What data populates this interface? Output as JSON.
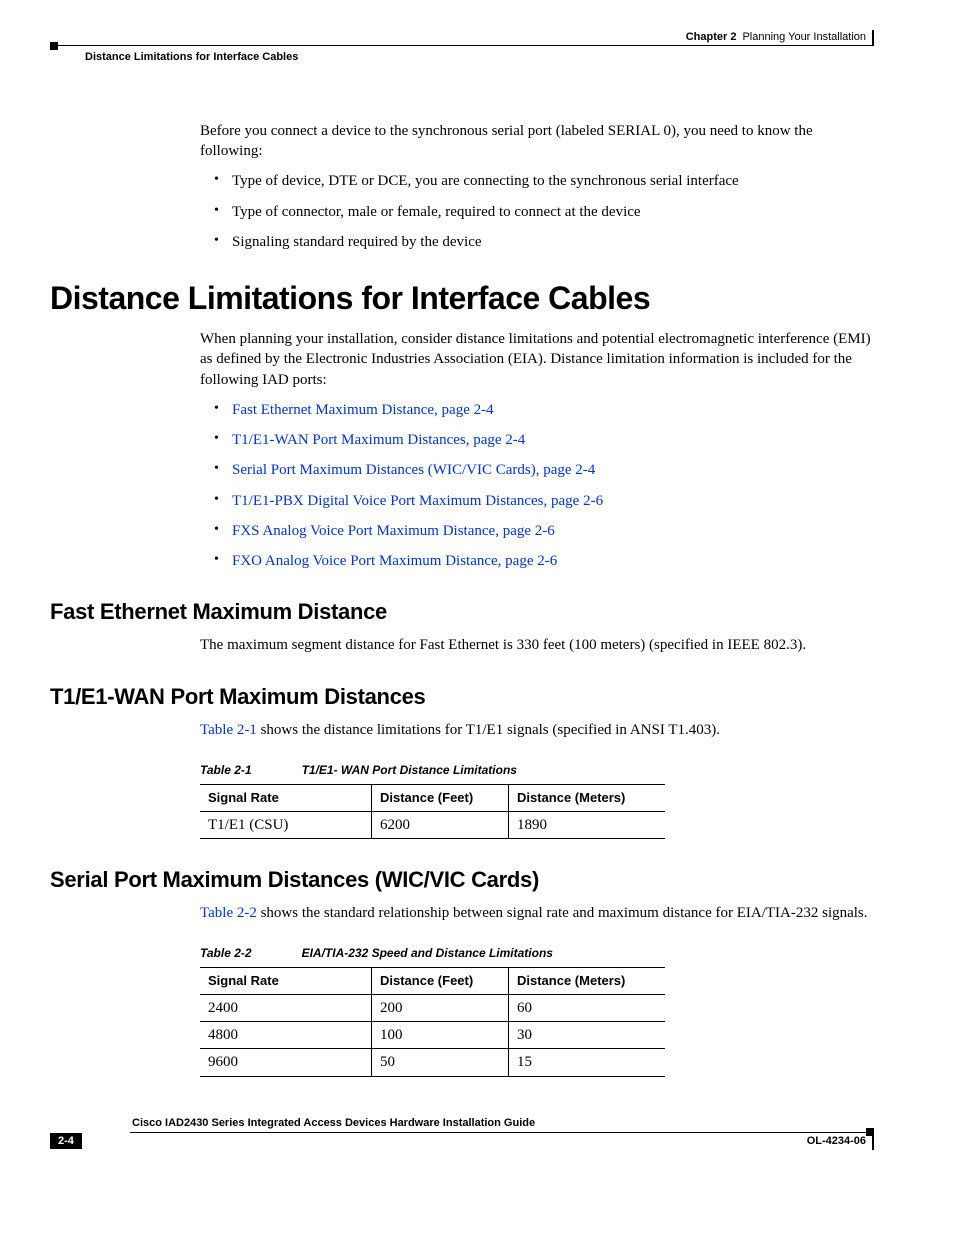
{
  "header": {
    "chapter_label": "Chapter 2",
    "chapter_title": "Planning Your Installation",
    "section_crumb": "Distance Limitations for Interface Cables"
  },
  "intro": {
    "p1": "Before you connect a device to the synchronous serial port (labeled SERIAL 0), you need to know the following:",
    "bullets": [
      "Type of device, DTE or DCE, you are connecting to the synchronous serial interface",
      "Type of connector, male or female, required to connect at the device",
      "Signaling standard required by the device"
    ]
  },
  "h1": "Distance Limitations for Interface Cables",
  "para_after_h1": "When planning your installation, consider distance limitations and potential electromagnetic interference (EMI) as defined by the Electronic Industries Association (EIA). Distance limitation information is included for the following IAD ports:",
  "links": [
    "Fast Ethernet Maximum Distance, page 2-4",
    "T1/E1-WAN Port Maximum Distances, page 2-4",
    "Serial Port Maximum Distances (WIC/VIC Cards), page 2-4",
    "T1/E1-PBX Digital Voice Port Maximum Distances, page 2-6",
    "FXS Analog Voice Port Maximum Distance, page 2-6",
    "FXO Analog Voice Port Maximum Distance, page 2-6"
  ],
  "sec1": {
    "h": "Fast Ethernet Maximum Distance",
    "p": "The maximum segment distance for Fast Ethernet is 330 feet (100 meters) (specified in IEEE 802.3)."
  },
  "sec2": {
    "h": "T1/E1-WAN Port Maximum Distances",
    "ref": "Table 2-1",
    "rest": " shows the distance limitations for T1/E1 signals (specified in ANSI T1.403).",
    "table_num": "Table 2-1",
    "table_title": "T1/E1- WAN Port Distance Limitations",
    "cols": [
      "Signal Rate",
      "Distance (Feet)",
      "Distance (Meters)"
    ],
    "rows": [
      [
        "T1/E1 (CSU)",
        "6200",
        "1890"
      ]
    ]
  },
  "sec3": {
    "h": "Serial Port Maximum Distances (WIC/VIC Cards)",
    "ref": "Table 2-2",
    "rest": " shows the standard relationship between signal rate and maximum distance for EIA/TIA-232 signals.",
    "table_num": "Table 2-2",
    "table_title": "EIA/TIA-232 Speed and Distance Limitations",
    "cols": [
      "Signal Rate",
      "Distance (Feet)",
      "Distance (Meters)"
    ],
    "rows": [
      [
        "2400",
        "200",
        "60"
      ],
      [
        "4800",
        "100",
        "30"
      ],
      [
        "9600",
        "50",
        "15"
      ]
    ]
  },
  "chart_data": [
    {
      "type": "table",
      "title": "T1/E1- WAN Port Distance Limitations",
      "columns": [
        "Signal Rate",
        "Distance (Feet)",
        "Distance (Meters)"
      ],
      "rows": [
        [
          "T1/E1 (CSU)",
          6200,
          1890
        ]
      ]
    },
    {
      "type": "table",
      "title": "EIA/TIA-232 Speed and Distance Limitations",
      "columns": [
        "Signal Rate",
        "Distance (Feet)",
        "Distance (Meters)"
      ],
      "rows": [
        [
          2400,
          200,
          60
        ],
        [
          4800,
          100,
          30
        ],
        [
          9600,
          50,
          15
        ]
      ]
    }
  ],
  "footer": {
    "guide": "Cisco IAD2430 Series Integrated Access Devices Hardware Installation Guide",
    "pagenum": "2-4",
    "doc": "OL-4234-06"
  }
}
